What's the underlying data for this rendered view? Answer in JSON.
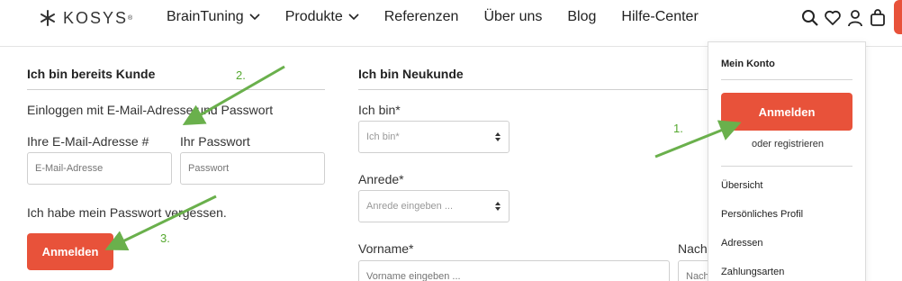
{
  "header": {
    "logo_text": "KOSYS",
    "logo_mark": "®",
    "nav": [
      {
        "label": "BrainTuning",
        "has_dropdown": true
      },
      {
        "label": "Produkte",
        "has_dropdown": true
      },
      {
        "label": "Referenzen",
        "has_dropdown": false
      },
      {
        "label": "Über uns",
        "has_dropdown": false
      },
      {
        "label": "Blog",
        "has_dropdown": false
      },
      {
        "label": "Hilfe-Center",
        "has_dropdown": false
      }
    ],
    "icons": [
      "search-icon",
      "heart-icon",
      "user-icon",
      "bag-icon"
    ],
    "accent_color": "#e8523a"
  },
  "existing_customer": {
    "title": "Ich bin bereits Kunde",
    "intro": "Einloggen mit E-Mail-Adresse und Passwort",
    "email_label": "Ihre E-Mail-Adresse #",
    "email_placeholder": "E-Mail-Adresse",
    "password_label": "Ihr Passwort",
    "password_placeholder": "Passwort",
    "forgot_link": "Ich habe mein Passwort vergessen.",
    "login_button": "Anmelden"
  },
  "new_customer": {
    "title": "Ich bin Neukunde",
    "iam_label": "Ich bin*",
    "iam_placeholder": "Ich bin*",
    "salutation_label": "Anrede*",
    "salutation_placeholder": "Anrede eingeben ...",
    "firstname_label": "Vorname*",
    "firstname_placeholder": "Vorname eingeben ...",
    "lastname_label": "Nachn",
    "lastname_placeholder": "Nach"
  },
  "account_menu": {
    "title": "Mein Konto",
    "login_button": "Anmelden",
    "or_register": "oder registrieren",
    "links": [
      "Übersicht",
      "Persönliches Profil",
      "Adressen",
      "Zahlungsarten"
    ]
  },
  "annotations": {
    "label_1": "1.",
    "label_2": "2.",
    "label_3": "3.",
    "arrow_color": "#6ab04c"
  }
}
